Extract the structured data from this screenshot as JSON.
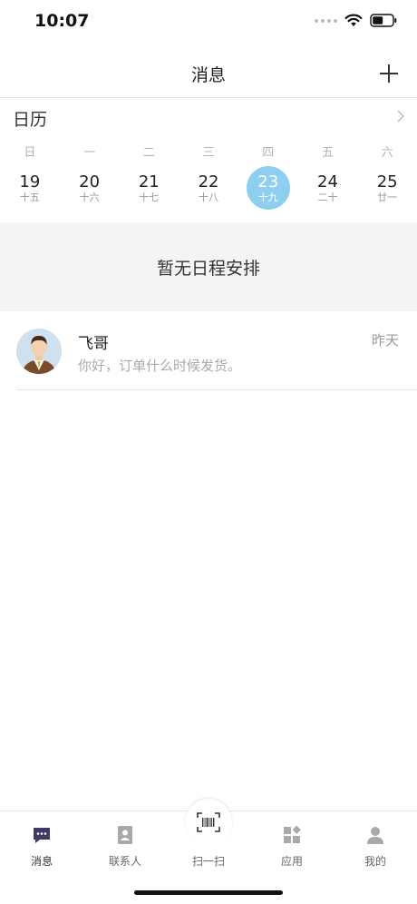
{
  "status_bar": {
    "time": "10:07"
  },
  "header": {
    "title": "消息",
    "add_icon": "plus-icon"
  },
  "calendar": {
    "title": "日历",
    "weekdays": [
      "日",
      "一",
      "二",
      "三",
      "四",
      "五",
      "六"
    ],
    "dates": [
      {
        "day": "19",
        "lunar": "十五"
      },
      {
        "day": "20",
        "lunar": "十六"
      },
      {
        "day": "21",
        "lunar": "十七"
      },
      {
        "day": "22",
        "lunar": "十八"
      },
      {
        "day": "23",
        "lunar": "十九"
      },
      {
        "day": "24",
        "lunar": "二十"
      },
      {
        "day": "25",
        "lunar": "廿一"
      }
    ],
    "selected_day": "23",
    "selected_color": "#8ecff0"
  },
  "schedule": {
    "empty_text": "暂无日程安排"
  },
  "chats": [
    {
      "name": "飞哥",
      "time": "昨天",
      "message": "你好，订单什么时候发货。"
    }
  ],
  "tabbar": {
    "items": [
      {
        "label": "消息",
        "icon": "chat-bubble-icon"
      },
      {
        "label": "联系人",
        "icon": "contact-card-icon"
      },
      {
        "label": "扫一扫",
        "icon": "barcode-scan-icon"
      },
      {
        "label": "应用",
        "icon": "apps-grid-icon"
      },
      {
        "label": "我的",
        "icon": "person-icon"
      }
    ]
  }
}
